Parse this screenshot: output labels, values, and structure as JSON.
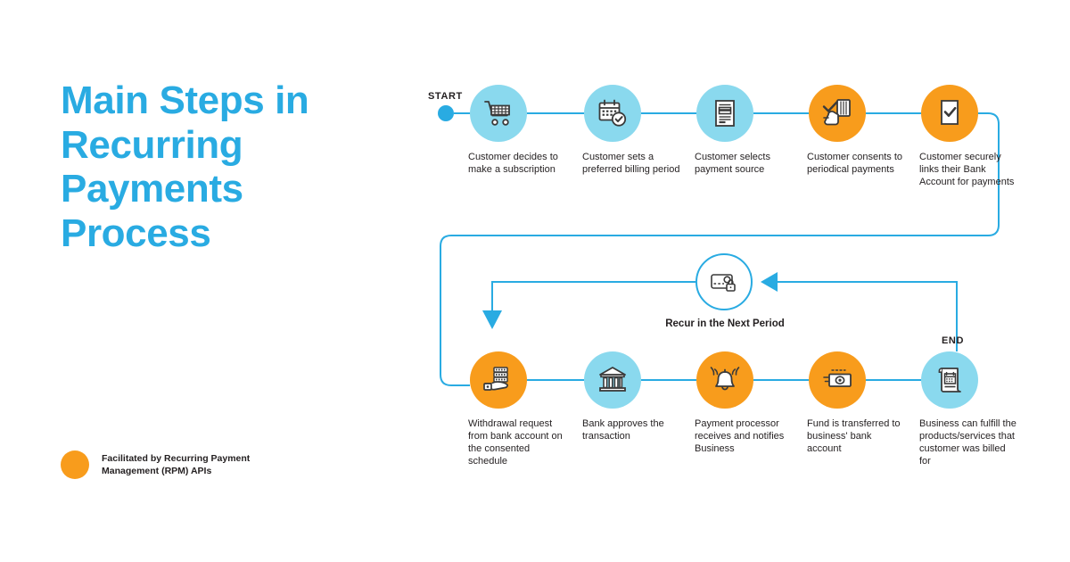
{
  "title": "Main Steps in Recurring Payments Process",
  "colors": {
    "accent_blue": "#29ABE2",
    "light_blue": "#8AD9EE",
    "orange": "#F89C1C",
    "text": "#231F20",
    "background": "#FFFFFF"
  },
  "markers": {
    "start": "START",
    "end": "END"
  },
  "loop": {
    "label": "Recur in the Next Period",
    "icon": "card-lock-icon"
  },
  "legend": {
    "text": "Facilitated by Recurring Payment Management (RPM) APIs",
    "swatch_color": "#F89C1C",
    "swatch_name": "orange-dot"
  },
  "steps": [
    {
      "index": 1,
      "row": "top",
      "caption": "Customer decides to make a subscription",
      "icon": "shopping-cart-icon",
      "style": "blue"
    },
    {
      "index": 2,
      "row": "top",
      "caption": "Customer sets a preferred billing period",
      "icon": "calendar-check-icon",
      "style": "blue"
    },
    {
      "index": 3,
      "row": "top",
      "caption": "Customer selects payment source",
      "icon": "document-icon",
      "style": "blue"
    },
    {
      "index": 4,
      "row": "top",
      "caption": "Customer consents to periodical payments",
      "icon": "hand-card-check-icon",
      "style": "orange"
    },
    {
      "index": 5,
      "row": "top",
      "caption": "Customer securely links their Bank Account for payments",
      "icon": "checklist-approved-icon",
      "style": "orange"
    },
    {
      "index": 6,
      "row": "bottom",
      "caption": "Withdrawal request from bank account on the consented schedule",
      "icon": "hand-money-icon",
      "style": "orange"
    },
    {
      "index": 7,
      "row": "bottom",
      "caption": "Bank approves the transaction",
      "icon": "bank-icon",
      "style": "blue"
    },
    {
      "index": 8,
      "row": "bottom",
      "caption": "Payment processor receives and notifies Business",
      "icon": "bell-icon",
      "style": "orange"
    },
    {
      "index": 9,
      "row": "bottom",
      "caption": "Fund is transferred to business' bank account",
      "icon": "banknote-icon",
      "style": "orange"
    },
    {
      "index": 10,
      "row": "bottom",
      "caption": "Business can fulfill the products/services that customer was billed for",
      "icon": "invoice-scroll-icon",
      "style": "blue"
    }
  ]
}
